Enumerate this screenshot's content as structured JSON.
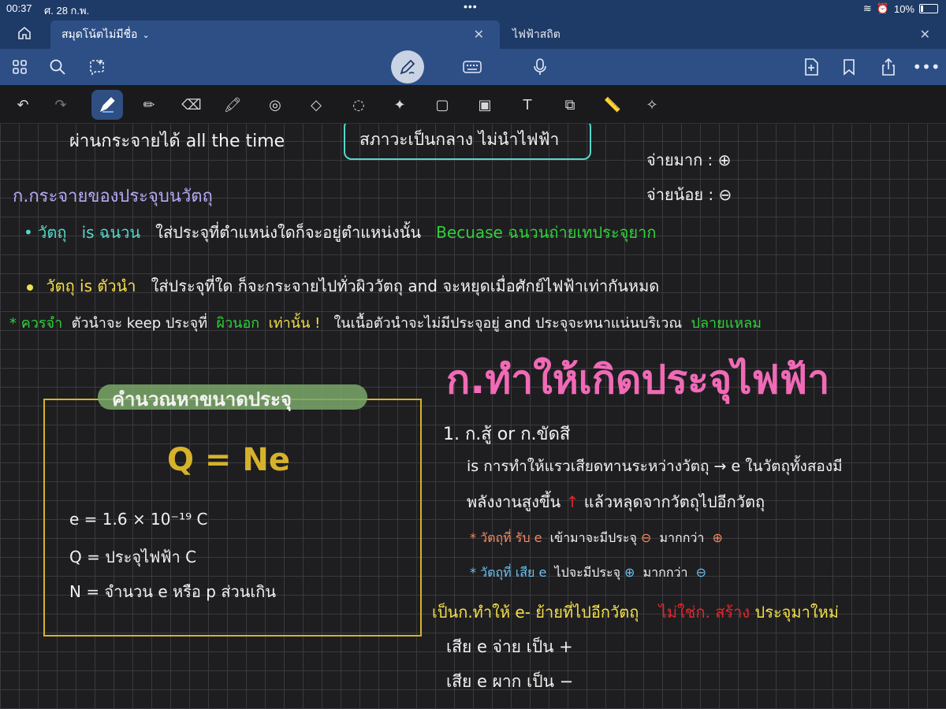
{
  "status": {
    "time": "00:37",
    "date": "ศ. 28 ก.พ.",
    "battery": "10%"
  },
  "tabs": [
    {
      "label": "สมุดโน้ตไม่มีชื่อ",
      "active": true
    },
    {
      "label": "ไฟฟ้าสถิต",
      "active": false
    }
  ],
  "icons": {
    "home": "home-icon",
    "grid": "grid-icon",
    "search": "search-icon",
    "lasso_ai": "ai-sparkle-icon",
    "pen_mode": "pen-mode-icon",
    "keyboard": "keyboard-icon",
    "mic": "microphone-icon",
    "add_page": "add-page-icon",
    "bookmark": "bookmark-icon",
    "share": "share-icon",
    "more": "more-icon"
  },
  "colors": {
    "swatches": [
      "#ffffff",
      "#c7c2f7",
      "#6fe0d3",
      "#f7ee77"
    ]
  },
  "notes": {
    "l1": "ผ่านกระจายได้ all the time",
    "box1": "สภาวะเป็นกลาง ไม่นำไฟฟ้า",
    "r1": "จ่ายมาก : ⊕",
    "r2": "จ่ายน้อย : ⊖",
    "h1": "ก.กระจายของประจุบนวัตถุ",
    "b1_a": "วัตถุ",
    "b1_b": "is ฉนวน",
    "b1_c": "ใส่ประจุที่ตำแหน่งใดก็จะอยู่ตำแหน่งนั้น",
    "b1_d": "Becuase ฉนวนถ่ายเทประจุยาก",
    "b2_a": "วัตถุ is ตัวนำ",
    "b2_b": "ใส่ประจุที่ใด ก็จะกระจายไปทั่วผิววัตถุ and จะหยุดเมื่อศักย์ไฟฟ้าเท่ากันหมด",
    "n1_a": "* ควรจำ",
    "n1_b": "ตัวนำจะ keep ประจุที่",
    "n1_c": "ผิวนอก",
    "n1_d": "เท่านั้น !",
    "n1_e": "ในเนื้อตัวนำจะไม่มีประจุอยู่ and ประจุจะหนาแน่นบริเวณ",
    "n1_f": "ปลายแหลม",
    "calc_title": "คำนวณหาขนาดประจุ",
    "formula": "Q = Ne",
    "e_def": "e = 1.6 × 10⁻¹⁹ C",
    "q_def": "Q = ประจุไฟฟ้า C",
    "n_def": "N = จำนวน e หรือ p ส่วนเกิน",
    "h2": "ก.ทำให้เกิดประจุไฟฟ้า",
    "s1": "1. ก.สู้ or ก.ขัดสี",
    "s1_a": "is การทำให้แรวเสียดทานระหว่างวัตถุ → e ในวัตถุทั้งสองมี",
    "s1_b": "พลังงานสูงขึ้น",
    "s1_arrow": "↑",
    "s1_c": "แล้วหลุดจากวัตถุไปอีกวัตถุ",
    "s1_d1": "* วัตถุที่",
    "s1_d2": "รับ e",
    "s1_d3": "เข้ามาจะมีประจุ",
    "s1_d4": "⊖",
    "s1_d5": "มากกว่า",
    "s1_d6": "⊕",
    "s1_e1": "* วัตถุที่",
    "s1_e2": "เสีย e",
    "s1_e3": "ไปจะมีประจุ",
    "s1_e4": "⊕",
    "s1_e5": "มากกว่า",
    "s1_e6": "⊖",
    "s2_a": "เป็นก.ทำให้ e- ย้ายที่ไปอีกวัตถุ",
    "s2_b": "ไม่ใช่ก.",
    "s2_c": "สร้าง",
    "s2_d": "ประจุมาใหม่",
    "s3": "เสีย e จ่าย เป็น +",
    "s4": "เสีย e ผาก เป็น −"
  }
}
